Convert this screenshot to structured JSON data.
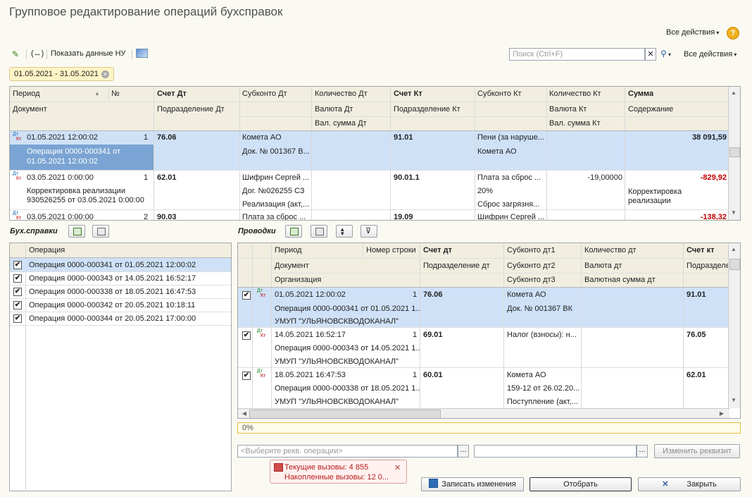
{
  "window": {
    "title": "Групповое редактирование операций бухсправок"
  },
  "top_actions": {
    "all_actions": "Все действия",
    "help": "?"
  },
  "toolbar": {
    "show_nu": "Показать данные НУ",
    "all_actions": "Все действия"
  },
  "search": {
    "placeholder": "Поиск (Ctrl+F)",
    "clear": "✕"
  },
  "filter_chip": {
    "label": "01.05.2021 - 31.05.2021",
    "remove": "✕"
  },
  "main_table": {
    "headers": {
      "period": "Период",
      "num": "№",
      "acc_dt": "Счет Дт",
      "sub_dt": "Субконто Дт",
      "qty_dt": "Количество Дт",
      "acc_kt": "Счет Кт",
      "sub_kt": "Субконто Кт",
      "qty_kt": "Количество Кт",
      "sum": "Сумма",
      "document": "Документ",
      "dept_dt": "Подразделение Дт",
      "cur_dt": "Валюта Дт",
      "dept_kt": "Подразделение Кт",
      "cur_kt": "Валюта Кт",
      "content": "Содержание",
      "cursum_dt": "Вал. сумма Дт",
      "cursum_kt": "Вал. сумма Кт"
    },
    "rows": [
      {
        "period": "01.05.2021 12:00:02",
        "num": "1",
        "acc_dt": "76.06",
        "sub_dt1": "Комета АО",
        "sub_dt2": "Док. № 001367 В...",
        "qty_dt": "",
        "acc_kt": "91.01",
        "sub_kt1": "Пени (за наруше...",
        "sub_kt2": "Комета АО",
        "sub_kt3": "",
        "qty_kt": "",
        "sum": "38 091,59",
        "doc1": "Операция 0000-000341 от",
        "doc2": "01.05.2021 12:00:02",
        "content1": "",
        "content2": ""
      },
      {
        "period": "03.05.2021 0:00:00",
        "num": "1",
        "acc_dt": "62.01",
        "sub_dt1": "Шифрин Сергей ...",
        "sub_dt2": "Дог. №026255 СЗ",
        "sub_dt3": "Реализация (акт,...",
        "qty_dt": "",
        "acc_kt": "90.01.1",
        "sub_kt1": "Плата за сброс ...",
        "sub_kt2": "20%",
        "sub_kt3": "Сброс загрязня...",
        "qty_kt": "-19,00000",
        "sum": "-829,92",
        "doc1": "Корректировка реализации",
        "doc2": "930526255 от 03.05.2021 0:00:00",
        "content1": "Корректировка",
        "content2": "реализации"
      },
      {
        "period": "03.05.2021 0:00:00",
        "num": "2",
        "acc_dt": "90.03",
        "sub_dt1": "Плата за сброс ...",
        "acc_kt": "19.09",
        "sub_kt1": "Шифрин Сергей ...",
        "sum": "-138,32"
      }
    ]
  },
  "left_panel": {
    "label": "Бух.справки",
    "col_operation": "Операция",
    "items": [
      {
        "text": "Операция 0000-000341 от 01.05.2021 12:00:02",
        "checked": "✔"
      },
      {
        "text": "Операция 0000-000343 от 14.05.2021 16:52:17",
        "checked": "✔"
      },
      {
        "text": "Операция 0000-000338 от 18.05.2021 16:47:53",
        "checked": "✔"
      },
      {
        "text": "Операция 0000-000342 от 20.05.2021 10:18:11",
        "checked": "✔"
      },
      {
        "text": "Операция 0000-000344 от 20.05.2021 17:00:00",
        "checked": "✔"
      }
    ]
  },
  "right_panel": {
    "label": "Проводки",
    "headers": {
      "period": "Период",
      "line_no": "Номер строки",
      "acc_dt": "Счет дт",
      "sub_dt1": "Субконто дт1",
      "qty_dt": "Количество дт",
      "acc_kt": "Счет кт",
      "document": "Документ",
      "dept_dt": "Подразделение дт",
      "sub_dt2": "Субконто дт2",
      "cur_dt": "Валюта дт",
      "dept_kt": "Подразделе",
      "org": "Организация",
      "sub_dt3": "Субконто дт3",
      "cursum_dt": "Валютная сумма дт"
    },
    "rows": [
      {
        "checked": "✔",
        "period": "01.05.2021 12:00:02",
        "line_no": "1",
        "acc_dt": "76.06",
        "sub1": "Комета АО",
        "sub2": "Док. № 001367 ВК",
        "sub3": "",
        "acc_kt": "91.01",
        "doc": "Операция 0000-000341 от 01.05.2021 1...",
        "org": "УМУП \"УЛЬЯНОВСКВОДОКАНАЛ\""
      },
      {
        "checked": "✔",
        "period": "14.05.2021 16:52:17",
        "line_no": "1",
        "acc_dt": "69.01",
        "sub1": "Налог (взносы): н...",
        "sub2": "",
        "sub3": "",
        "acc_kt": "76.05",
        "doc": "Операция 0000-000343 от 14.05.2021 1...",
        "org": "УМУП \"УЛЬЯНОВСКВОДОКАНАЛ\""
      },
      {
        "checked": "✔",
        "period": "18.05.2021 16:47:53",
        "line_no": "1",
        "acc_dt": "60.01",
        "sub1": "Комета АО",
        "sub2": "159-12 от 26.02.20...",
        "sub3": "Поступление (акт,...",
        "acc_kt": "62.01",
        "doc": "Операция 0000-000338 от 18.05.2021 1...",
        "org": "УМУП \"УЛЬЯНОВСКВОДОКАНАЛ\""
      }
    ]
  },
  "progress": {
    "value": "0%",
    "fraction": 0
  },
  "req_select": {
    "placeholder": "<Выберите рекв. операции>"
  },
  "change_button": "Изменить реквизит",
  "calls": {
    "current": "Текущие вызовы: 4 855",
    "accumulated": "Накопленные вызовы: 12 0...",
    "close": "✕"
  },
  "buttons": {
    "save": "Записать изменения",
    "select": "Отобрать",
    "close": "Закрыть"
  },
  "dtkt": {
    "dt": "Дт",
    "kt": "Кт"
  },
  "colors": {
    "selection": "#cfe1f7",
    "selection_dark": "#7aa4d3",
    "negative": "#c00000",
    "progress_border": "#e0c040"
  }
}
